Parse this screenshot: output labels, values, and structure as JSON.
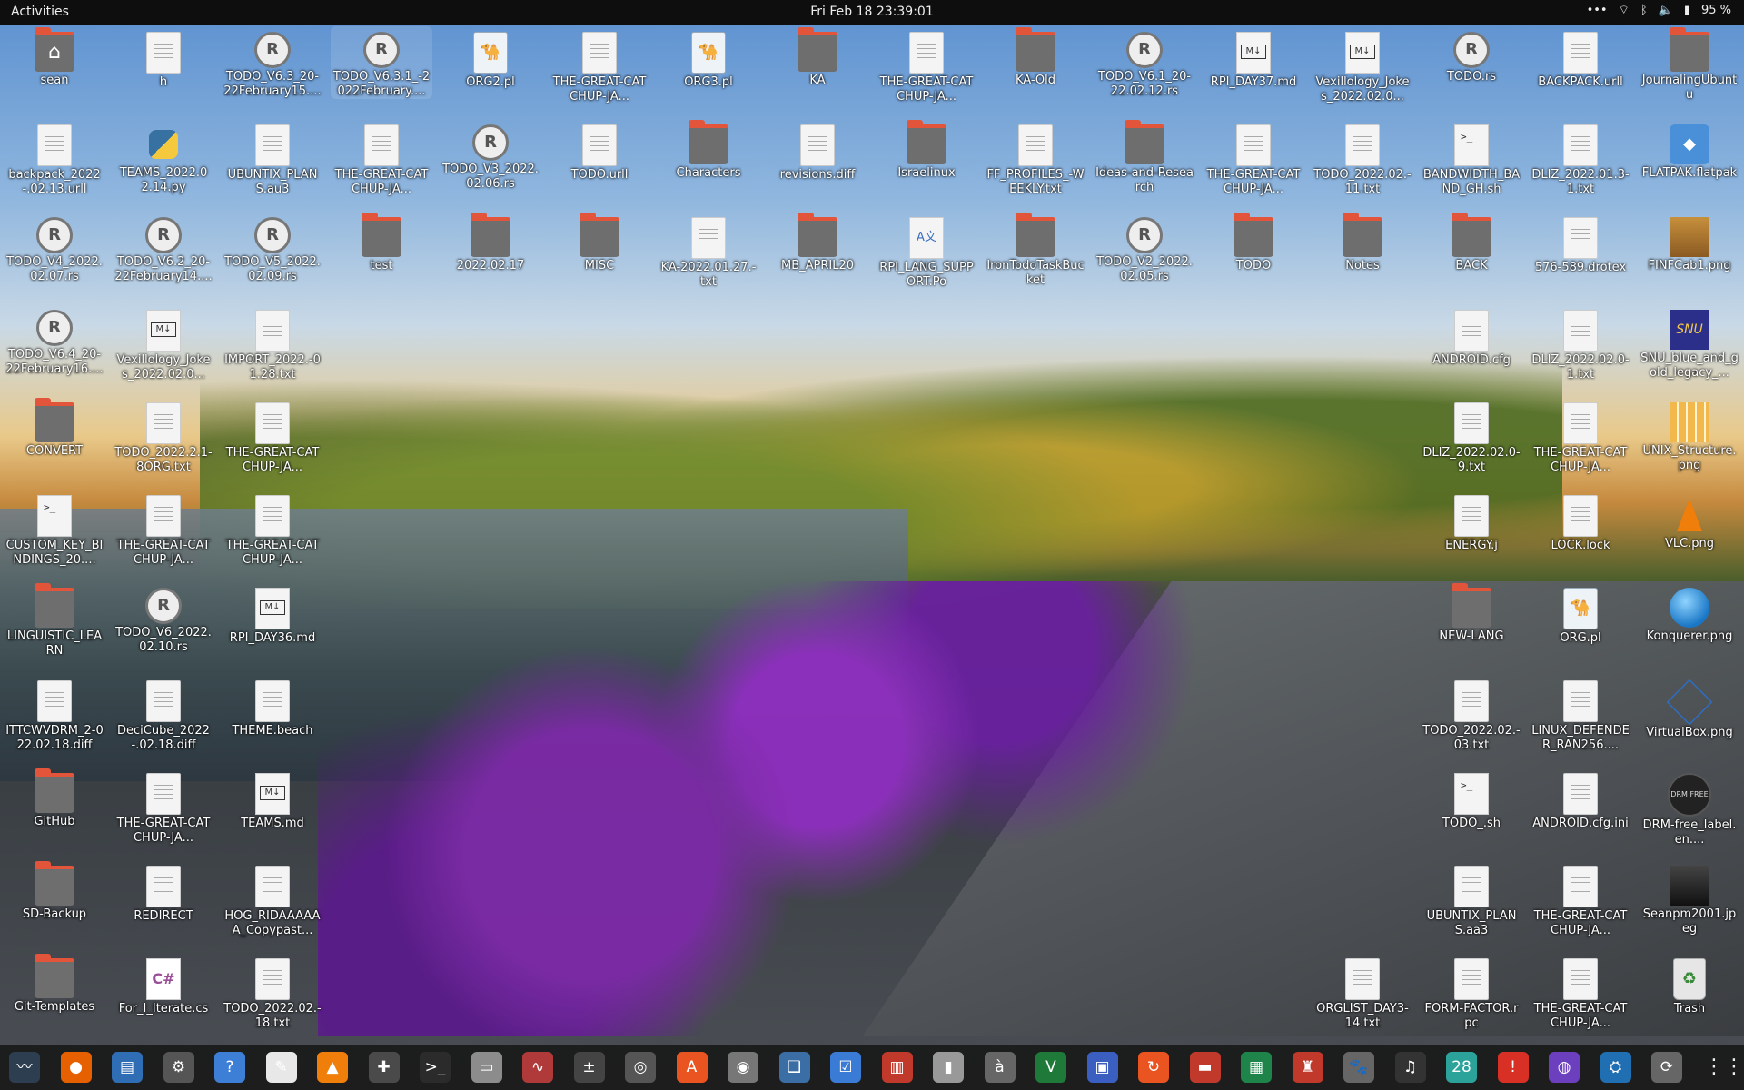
{
  "topbar": {
    "activities": "Activities",
    "clock": "Fri Feb 18  23:39:01",
    "battery": "95 %"
  },
  "desktop": {
    "icons": [
      {
        "label": "sean",
        "type": "folder-home"
      },
      {
        "label": "h",
        "type": "doc"
      },
      {
        "label": "TODO_V6.3_20-22February15....",
        "type": "rs"
      },
      {
        "label": "TODO_V6.3.1_-2022February....",
        "type": "rs"
      },
      {
        "label": "ORG2.pl",
        "type": "pl"
      },
      {
        "label": "THE-GREAT-CATCHUP-JA...",
        "type": "doc"
      },
      {
        "label": "ORG3.pl",
        "type": "pl"
      },
      {
        "label": "KA",
        "type": "folder"
      },
      {
        "label": "THE-GREAT-CATCHUP-JA...",
        "type": "doc"
      },
      {
        "label": "KA-Old",
        "type": "folder"
      },
      {
        "label": "TODO_V6.1_20-22.02.12.rs",
        "type": "rs"
      },
      {
        "label": "RPI_DAY37.md",
        "type": "md"
      },
      {
        "label": "Vexillology_Jokes_2022.02.0...",
        "type": "md"
      },
      {
        "label": "TODO.rs",
        "type": "rs"
      },
      {
        "label": "BACKPACK.urll",
        "type": "doc"
      },
      {
        "label": "JournalingUbuntu",
        "type": "folder"
      },
      {
        "label": "backpack_2022-.02.13.urll",
        "type": "doc"
      },
      {
        "label": "TEAMS_2022.02.14.py",
        "type": "py"
      },
      {
        "label": "UBUNTIX_PLANS.au3",
        "type": "doc"
      },
      {
        "label": "THE-GREAT-CATCHUP-JA...",
        "type": "doc"
      },
      {
        "label": "TODO_V3_2022.02.06.rs",
        "type": "rs"
      },
      {
        "label": "TODO.urll",
        "type": "doc"
      },
      {
        "label": "Characters",
        "type": "folder"
      },
      {
        "label": "revisions.diff",
        "type": "doc"
      },
      {
        "label": "Israelinux",
        "type": "folder"
      },
      {
        "label": "FF_PROFILES_-WEEKLY.txt",
        "type": "doc"
      },
      {
        "label": "Ideas-and-Research",
        "type": "folder"
      },
      {
        "label": "THE-GREAT-CATCHUP-JA...",
        "type": "doc"
      },
      {
        "label": "TODO_2022.02.-11.txt",
        "type": "doc"
      },
      {
        "label": "BANDWIDTH_BAND_GH.sh",
        "type": "sh"
      },
      {
        "label": "DLIZ_2022.01.3-1.txt",
        "type": "doc"
      },
      {
        "label": "FLATPAK.flatpak",
        "type": "flatpak"
      },
      {
        "label": "TODO_V4_2022.02.07.rs",
        "type": "rs"
      },
      {
        "label": "TODO_V6.2_20-22February14....",
        "type": "rs"
      },
      {
        "label": "TODO_V5_2022.02.09.rs",
        "type": "rs"
      },
      {
        "label": "test",
        "type": "folder"
      },
      {
        "label": "2022.02.17",
        "type": "folder"
      },
      {
        "label": "MISC",
        "type": "folder"
      },
      {
        "label": "KA-2022.01.27.-txt",
        "type": "doc"
      },
      {
        "label": "MB_APRIL20",
        "type": "folder"
      },
      {
        "label": "RPI_LANG_SUPPORT.Po",
        "type": "po"
      },
      {
        "label": "IronTodoTaskBucket",
        "type": "folder"
      },
      {
        "label": "TODO_V2_2022.02.05.rs",
        "type": "rs"
      },
      {
        "label": "TODO",
        "type": "folder"
      },
      {
        "label": "Notes",
        "type": "folder"
      },
      {
        "label": "BACK",
        "type": "folder"
      },
      {
        "label": "576-589.drotex",
        "type": "doc"
      },
      {
        "label": "FINFCab1.png",
        "type": "cabinet"
      },
      {
        "label": "TODO_V6.4_20-22February16....",
        "type": "rs"
      },
      {
        "label": "Vexillology_Jokes_2022.02.0...",
        "type": "md"
      },
      {
        "label": "IMPORT_2022.-01.28.txt",
        "type": "doc"
      },
      {
        "label": "ANDROID.cfg",
        "type": "doc"
      },
      {
        "label": "DLIZ_2022.02.0-1.txt",
        "type": "doc"
      },
      {
        "label": "SNU_blue_and_gold_legacy_...",
        "type": "snu"
      },
      {
        "label": "CONVERT",
        "type": "folder"
      },
      {
        "label": "TODO_2022.2.1-8ORG.txt",
        "type": "doc"
      },
      {
        "label": "THE-GREAT-CATCHUP-JA...",
        "type": "doc"
      },
      {
        "label": "DLIZ_2022.02.0-9.txt",
        "type": "doc"
      },
      {
        "label": "THE-GREAT-CATCHUP-JA...",
        "type": "doc"
      },
      {
        "label": "UNIX_Structure.png",
        "type": "unix"
      },
      {
        "label": "CUSTOM_KEY_BINDINGS_20....",
        "type": "sh"
      },
      {
        "label": "THE-GREAT-CATCHUP-JA...",
        "type": "doc"
      },
      {
        "label": "THE-GREAT-CATCHUP-JA...",
        "type": "doc"
      },
      {
        "label": "ENERGY.j",
        "type": "doc"
      },
      {
        "label": "LOCK.lock",
        "type": "doc"
      },
      {
        "label": "VLC.png",
        "type": "vlc"
      },
      {
        "label": "LINGUISTIC_LEARN",
        "type": "folder"
      },
      {
        "label": "TODO_V6_2022.02.10.rs",
        "type": "rs"
      },
      {
        "label": "RPI_DAY36.md",
        "type": "md"
      },
      {
        "label": "NEW-LANG",
        "type": "folder"
      },
      {
        "label": "ORG.pl",
        "type": "pl"
      },
      {
        "label": "Konquerer.png",
        "type": "globe"
      },
      {
        "label": "ITTCWVDRM_2-022.02.18.diff",
        "type": "doc"
      },
      {
        "label": "DeciCube_2022-.02.18.diff",
        "type": "doc"
      },
      {
        "label": "THEME.beach",
        "type": "doc"
      },
      {
        "label": "TODO_2022.02.-03.txt",
        "type": "doc"
      },
      {
        "label": "LINUX_DEFENDER_RAN256....",
        "type": "doc"
      },
      {
        "label": "VirtualBox.png",
        "type": "vbox"
      },
      {
        "label": "GitHub",
        "type": "folder"
      },
      {
        "label": "THE-GREAT-CATCHUP-JA...",
        "type": "doc"
      },
      {
        "label": "TEAMS.md",
        "type": "md"
      },
      {
        "label": "TODO_.sh",
        "type": "sh"
      },
      {
        "label": "ANDROID.cfg.ini",
        "type": "doc"
      },
      {
        "label": "DRM-free_label.en....",
        "type": "drm"
      },
      {
        "label": "SD-Backup",
        "type": "folder"
      },
      {
        "label": "REDIRECT",
        "type": "doc"
      },
      {
        "label": "HOG_RIDAAAAAA_Copypast...",
        "type": "doc"
      },
      {
        "label": "UBUNTIX_PLANS.aa3",
        "type": "doc"
      },
      {
        "label": "THE-GREAT-CATCHUP-JA...",
        "type": "doc"
      },
      {
        "label": "Seanpm2001.jpeg",
        "type": "photo"
      },
      {
        "label": "Git-Templates",
        "type": "folder"
      },
      {
        "label": "For_I_Iterate.cs",
        "type": "cs"
      },
      {
        "label": "TODO_2022.02.-18.txt",
        "type": "doc"
      },
      {
        "label": "ORGLIST_DAY3-14.txt",
        "type": "doc"
      },
      {
        "label": "FORM-FACTOR.rpc",
        "type": "doc"
      },
      {
        "label": "THE-GREAT-CATCHUP-JA...",
        "type": "doc"
      },
      {
        "label": "Trash",
        "type": "trash"
      }
    ]
  },
  "dock": {
    "apps": [
      {
        "name": "system-monitor",
        "glyph": "〰",
        "color": "#2c3e50"
      },
      {
        "name": "firefox",
        "glyph": "●",
        "color": "#e66000"
      },
      {
        "name": "files-manager",
        "glyph": "▤",
        "color": "#2f6db5"
      },
      {
        "name": "settings",
        "glyph": "⚙",
        "color": "#555"
      },
      {
        "name": "help",
        "glyph": "?",
        "color": "#3d7fd6"
      },
      {
        "name": "text-editor",
        "glyph": "✎",
        "color": "#e8e8e8"
      },
      {
        "name": "vlc",
        "glyph": "▲",
        "color": "#f07e0a"
      },
      {
        "name": "puzzle",
        "glyph": "✚",
        "color": "#4a4a4a"
      },
      {
        "name": "terminal",
        "glyph": ">_",
        "color": "#2b2b2b"
      },
      {
        "name": "folder",
        "glyph": "▭",
        "color": "#8c8c8c"
      },
      {
        "name": "system-monitor-2",
        "glyph": "∿",
        "color": "#b03a3a"
      },
      {
        "name": "calculator",
        "glyph": "±",
        "color": "#444"
      },
      {
        "name": "image-viewer",
        "glyph": "◎",
        "color": "#555"
      },
      {
        "name": "software-store",
        "glyph": "A",
        "color": "#e95420"
      },
      {
        "name": "disc",
        "glyph": "◉",
        "color": "#777"
      },
      {
        "name": "book",
        "glyph": "❑",
        "color": "#3a6ea5"
      },
      {
        "name": "tasks",
        "glyph": "☑",
        "color": "#3a7bd5"
      },
      {
        "name": "document-viewer",
        "glyph": "▥",
        "color": "#c0392b"
      },
      {
        "name": "archive",
        "glyph": "▮",
        "color": "#999"
      },
      {
        "name": "character-map",
        "glyph": "à",
        "color": "#666"
      },
      {
        "name": "vim",
        "glyph": "V",
        "color": "#1f7a3a"
      },
      {
        "name": "remote-desktop",
        "glyph": "▣",
        "color": "#3b5fc0"
      },
      {
        "name": "backup",
        "glyph": "↻",
        "color": "#e95420"
      },
      {
        "name": "pdf-reader",
        "glyph": "▬",
        "color": "#c0392b"
      },
      {
        "name": "spreadsheet",
        "glyph": "▦",
        "color": "#1e8449"
      },
      {
        "name": "mario",
        "glyph": "♜",
        "color": "#c0392b"
      },
      {
        "name": "gimp",
        "glyph": "🐾",
        "color": "#666"
      },
      {
        "name": "music",
        "glyph": "♫",
        "color": "#333"
      },
      {
        "name": "calendar",
        "glyph": "28",
        "color": "#2ba39b"
      },
      {
        "name": "alert",
        "glyph": "!",
        "color": "#d93025"
      },
      {
        "name": "screenshot",
        "glyph": "◍",
        "color": "#6c3fbf"
      },
      {
        "name": "app-bag",
        "glyph": "⛭",
        "color": "#1f6fb2"
      },
      {
        "name": "updates",
        "glyph": "⟳",
        "color": "#666"
      }
    ],
    "show_apps": "⋮⋮⋮"
  }
}
